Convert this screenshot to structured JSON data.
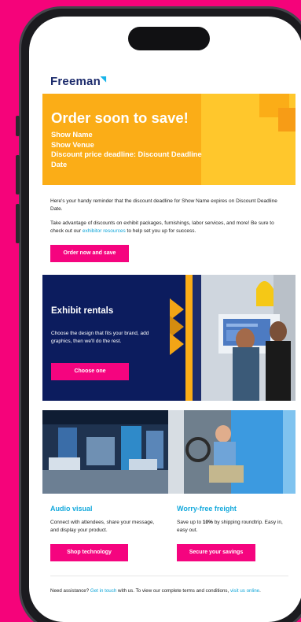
{
  "brand": {
    "logo_text": "Freeman"
  },
  "hero": {
    "title": "Order soon to save!",
    "line1": "Show Name",
    "line2": "Show Venue",
    "line3": "Discount price deadline: Discount Deadline Date",
    "bg_color": "#fbad17"
  },
  "intro": {
    "p1": "Here's your handy reminder that the discount deadline for Show Name expires on Discount Deadline Date.",
    "p2_before": "Take advantage of discounts on exhibit packages, furnishings, labor services, and more! Be sure to check out our ",
    "p2_link": "exhibitor resources",
    "p2_after": " to help set you up for success.",
    "cta": "Order now and save"
  },
  "rentals": {
    "title": "Exhibit rentals",
    "text": "Choose the design that fits your brand, add graphics, then we'll do the rest.",
    "cta": "Choose one",
    "bg_color": "#0c1c5e"
  },
  "audio_visual": {
    "title": "Audio visual",
    "text": "Connect with attendees, share your message, and display your product.",
    "cta": "Shop technology"
  },
  "freight": {
    "title": "Worry-free freight",
    "text_before": "Save up to ",
    "text_bold": "10%",
    "text_after": " by shipping roundtrip. Easy in, easy out.",
    "cta": "Secure your savings"
  },
  "footer": {
    "before": "Need assistance? ",
    "link1": "Get in touch",
    "middle": " with us. To view our complete terms and conditions, ",
    "link2": "visit us online",
    "after": "."
  },
  "colors": {
    "page_bg": "#f5037a",
    "accent": "#f5047f",
    "link": "#0ea5d8"
  }
}
